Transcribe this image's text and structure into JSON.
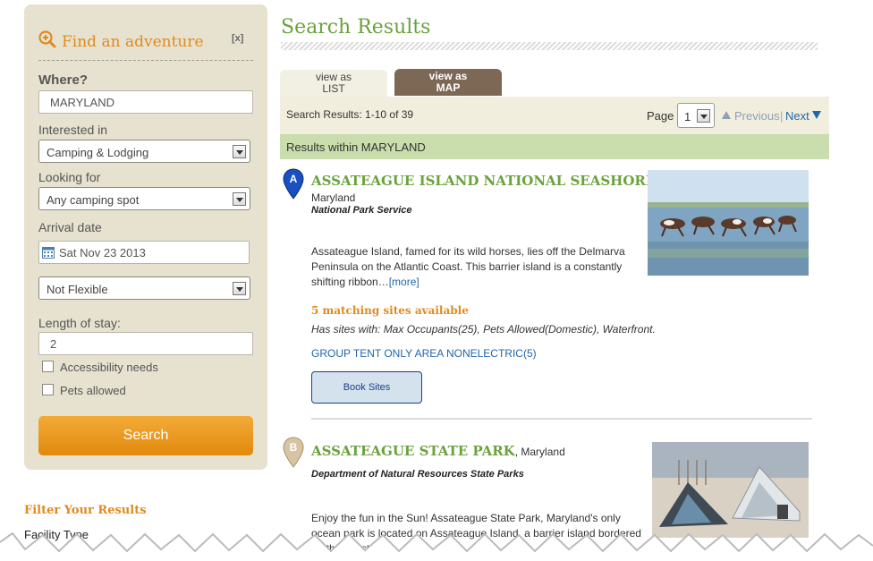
{
  "sidebar": {
    "title": "Find an adventure",
    "close": "[x]",
    "where_label": "Where?",
    "where_value": "MARYLAND",
    "interested_label": "Interested in",
    "interested_value": "Camping & Lodging",
    "looking_label": "Looking for",
    "looking_value": "Any camping spot",
    "arrival_label": "Arrival date",
    "arrival_value": "Sat Nov 23 2013",
    "flex_value": "Not Flexible",
    "length_label": "Length of stay:",
    "length_value": "2",
    "access_label": "Accessibility needs",
    "pets_label": "Pets allowed",
    "search_label": "Search",
    "filter_title": "Filter Your Results",
    "facility_type": "Facility Type"
  },
  "main": {
    "heading": "Search Results",
    "tab_list": [
      "view as",
      "LIST"
    ],
    "tab_map": [
      "view as",
      "MAP"
    ],
    "result_count": "Search Results: 1-10 of 39",
    "page_label": "Page",
    "page_value": "1",
    "previous": "Previous",
    "separator": "|",
    "next": "Next",
    "within": "Results within MARYLAND"
  },
  "results": [
    {
      "marker": "A",
      "title": "ASSATEAGUE ISLAND NATIONAL SEASHORE",
      "comma": ",",
      "state": "Maryland",
      "agency": "National Park Service",
      "desc": "Assateague Island, famed for its wild horses, lies off the Delmarva Peninsula on the Atlantic Coast. This barrier island is a constantly shifting ribbon…",
      "more": "[more]",
      "available": "5 matching sites available",
      "has_sites": "Has sites with: Max Occupants(25), Pets Allowed(Domestic), Waterfront.",
      "group": "GROUP TENT ONLY AREA NONELECTRIC(5)",
      "book": "Book Sites"
    },
    {
      "marker": "B",
      "title": "ASSATEAGUE STATE PARK",
      "state": ", Maryland",
      "agency": "Department of Natural Resources State Parks",
      "desc": "Enjoy the fun in the Sun! Assateague State Park, Maryland's only ocean park is located on Assateague Island, a barrier island bor",
      "desc_tail": "dered on the coast"
    }
  ],
  "colors": {
    "accent_orange": "#e08a1e",
    "title_green": "#6aa23c",
    "link_blue": "#2266aa",
    "sidebar_bg": "#e6e2cf",
    "within_bar": "#c9ddad",
    "map_tab": "#7d6856"
  }
}
